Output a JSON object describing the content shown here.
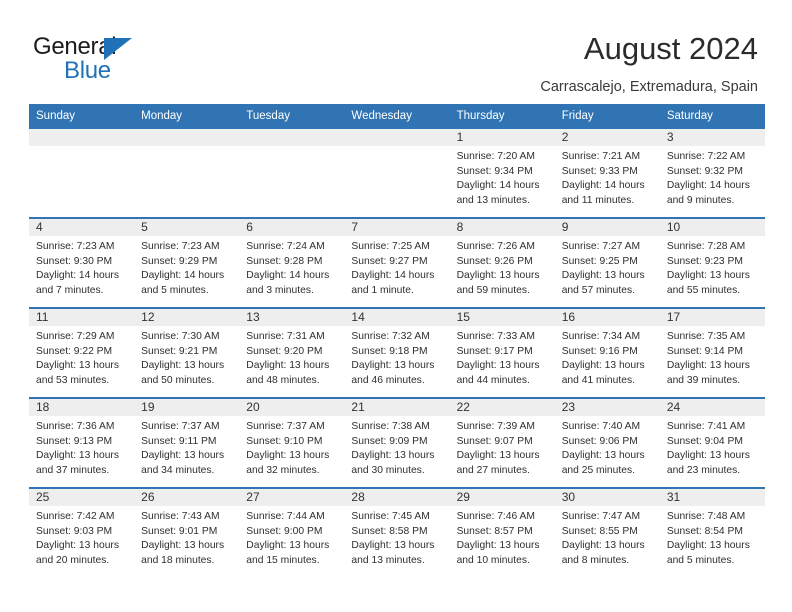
{
  "brand": {
    "name_top": "General",
    "name_bottom": "Blue",
    "accent_color": "#1f72b8"
  },
  "header": {
    "title": "August 2024",
    "subtitle": "Carrascalejo, Extremadura, Spain"
  },
  "calendar": {
    "header_bg": "#3074b4",
    "daynum_bg": "#eeeeee",
    "weekday_headers": [
      "Sunday",
      "Monday",
      "Tuesday",
      "Wednesday",
      "Thursday",
      "Friday",
      "Saturday"
    ],
    "weeks": [
      [
        {
          "day": "",
          "lines": []
        },
        {
          "day": "",
          "lines": []
        },
        {
          "day": "",
          "lines": []
        },
        {
          "day": "",
          "lines": []
        },
        {
          "day": "1",
          "lines": [
            "Sunrise: 7:20 AM",
            "Sunset: 9:34 PM",
            "Daylight: 14 hours",
            "and 13 minutes."
          ]
        },
        {
          "day": "2",
          "lines": [
            "Sunrise: 7:21 AM",
            "Sunset: 9:33 PM",
            "Daylight: 14 hours",
            "and 11 minutes."
          ]
        },
        {
          "day": "3",
          "lines": [
            "Sunrise: 7:22 AM",
            "Sunset: 9:32 PM",
            "Daylight: 14 hours",
            "and 9 minutes."
          ]
        }
      ],
      [
        {
          "day": "4",
          "lines": [
            "Sunrise: 7:23 AM",
            "Sunset: 9:30 PM",
            "Daylight: 14 hours",
            "and 7 minutes."
          ]
        },
        {
          "day": "5",
          "lines": [
            "Sunrise: 7:23 AM",
            "Sunset: 9:29 PM",
            "Daylight: 14 hours",
            "and 5 minutes."
          ]
        },
        {
          "day": "6",
          "lines": [
            "Sunrise: 7:24 AM",
            "Sunset: 9:28 PM",
            "Daylight: 14 hours",
            "and 3 minutes."
          ]
        },
        {
          "day": "7",
          "lines": [
            "Sunrise: 7:25 AM",
            "Sunset: 9:27 PM",
            "Daylight: 14 hours",
            "and 1 minute."
          ]
        },
        {
          "day": "8",
          "lines": [
            "Sunrise: 7:26 AM",
            "Sunset: 9:26 PM",
            "Daylight: 13 hours",
            "and 59 minutes."
          ]
        },
        {
          "day": "9",
          "lines": [
            "Sunrise: 7:27 AM",
            "Sunset: 9:25 PM",
            "Daylight: 13 hours",
            "and 57 minutes."
          ]
        },
        {
          "day": "10",
          "lines": [
            "Sunrise: 7:28 AM",
            "Sunset: 9:23 PM",
            "Daylight: 13 hours",
            "and 55 minutes."
          ]
        }
      ],
      [
        {
          "day": "11",
          "lines": [
            "Sunrise: 7:29 AM",
            "Sunset: 9:22 PM",
            "Daylight: 13 hours",
            "and 53 minutes."
          ]
        },
        {
          "day": "12",
          "lines": [
            "Sunrise: 7:30 AM",
            "Sunset: 9:21 PM",
            "Daylight: 13 hours",
            "and 50 minutes."
          ]
        },
        {
          "day": "13",
          "lines": [
            "Sunrise: 7:31 AM",
            "Sunset: 9:20 PM",
            "Daylight: 13 hours",
            "and 48 minutes."
          ]
        },
        {
          "day": "14",
          "lines": [
            "Sunrise: 7:32 AM",
            "Sunset: 9:18 PM",
            "Daylight: 13 hours",
            "and 46 minutes."
          ]
        },
        {
          "day": "15",
          "lines": [
            "Sunrise: 7:33 AM",
            "Sunset: 9:17 PM",
            "Daylight: 13 hours",
            "and 44 minutes."
          ]
        },
        {
          "day": "16",
          "lines": [
            "Sunrise: 7:34 AM",
            "Sunset: 9:16 PM",
            "Daylight: 13 hours",
            "and 41 minutes."
          ]
        },
        {
          "day": "17",
          "lines": [
            "Sunrise: 7:35 AM",
            "Sunset: 9:14 PM",
            "Daylight: 13 hours",
            "and 39 minutes."
          ]
        }
      ],
      [
        {
          "day": "18",
          "lines": [
            "Sunrise: 7:36 AM",
            "Sunset: 9:13 PM",
            "Daylight: 13 hours",
            "and 37 minutes."
          ]
        },
        {
          "day": "19",
          "lines": [
            "Sunrise: 7:37 AM",
            "Sunset: 9:11 PM",
            "Daylight: 13 hours",
            "and 34 minutes."
          ]
        },
        {
          "day": "20",
          "lines": [
            "Sunrise: 7:37 AM",
            "Sunset: 9:10 PM",
            "Daylight: 13 hours",
            "and 32 minutes."
          ]
        },
        {
          "day": "21",
          "lines": [
            "Sunrise: 7:38 AM",
            "Sunset: 9:09 PM",
            "Daylight: 13 hours",
            "and 30 minutes."
          ]
        },
        {
          "day": "22",
          "lines": [
            "Sunrise: 7:39 AM",
            "Sunset: 9:07 PM",
            "Daylight: 13 hours",
            "and 27 minutes."
          ]
        },
        {
          "day": "23",
          "lines": [
            "Sunrise: 7:40 AM",
            "Sunset: 9:06 PM",
            "Daylight: 13 hours",
            "and 25 minutes."
          ]
        },
        {
          "day": "24",
          "lines": [
            "Sunrise: 7:41 AM",
            "Sunset: 9:04 PM",
            "Daylight: 13 hours",
            "and 23 minutes."
          ]
        }
      ],
      [
        {
          "day": "25",
          "lines": [
            "Sunrise: 7:42 AM",
            "Sunset: 9:03 PM",
            "Daylight: 13 hours",
            "and 20 minutes."
          ]
        },
        {
          "day": "26",
          "lines": [
            "Sunrise: 7:43 AM",
            "Sunset: 9:01 PM",
            "Daylight: 13 hours",
            "and 18 minutes."
          ]
        },
        {
          "day": "27",
          "lines": [
            "Sunrise: 7:44 AM",
            "Sunset: 9:00 PM",
            "Daylight: 13 hours",
            "and 15 minutes."
          ]
        },
        {
          "day": "28",
          "lines": [
            "Sunrise: 7:45 AM",
            "Sunset: 8:58 PM",
            "Daylight: 13 hours",
            "and 13 minutes."
          ]
        },
        {
          "day": "29",
          "lines": [
            "Sunrise: 7:46 AM",
            "Sunset: 8:57 PM",
            "Daylight: 13 hours",
            "and 10 minutes."
          ]
        },
        {
          "day": "30",
          "lines": [
            "Sunrise: 7:47 AM",
            "Sunset: 8:55 PM",
            "Daylight: 13 hours",
            "and 8 minutes."
          ]
        },
        {
          "day": "31",
          "lines": [
            "Sunrise: 7:48 AM",
            "Sunset: 8:54 PM",
            "Daylight: 13 hours",
            "and 5 minutes."
          ]
        }
      ]
    ]
  }
}
